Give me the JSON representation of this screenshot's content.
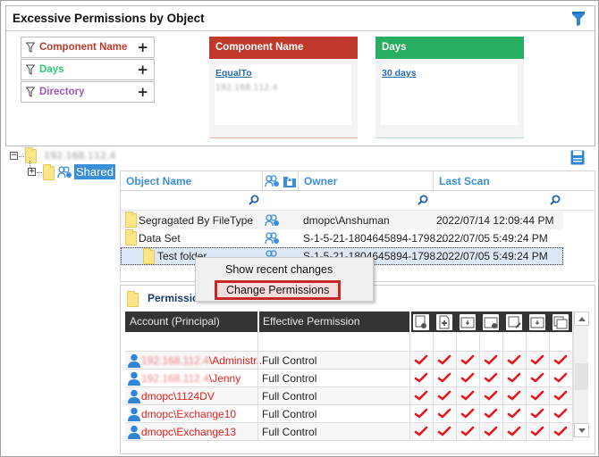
{
  "header": {
    "title": "Excessive Permissions by Object",
    "filter_icon": "funnel-icon"
  },
  "filters": [
    {
      "label": "Component Name",
      "color": "#c0392b",
      "icon": "filter-icon",
      "action": "+"
    },
    {
      "label": "Days",
      "color": "#27ae60",
      "icon": "filter-icon",
      "action": "+"
    },
    {
      "label": "Directory",
      "color": "#8e44ad",
      "icon": "filter-icon",
      "action": "+"
    }
  ],
  "cards": [
    {
      "title": "Component Name",
      "color": "#c0392b",
      "operator": "EqualTo",
      "value": "192.168.112.4"
    },
    {
      "title": "Days",
      "color": "#27ae60",
      "operator": "30 days",
      "value": ""
    }
  ],
  "tree": {
    "root": "192.168.112.4",
    "root_toggle": "−",
    "child": "Shared",
    "child_toggle": "+"
  },
  "grid": {
    "columns": [
      "Object Name",
      "Owner",
      "Last Scan"
    ],
    "rows": [
      {
        "name": "Segragated By FileType",
        "owner": "dmopc\\Anshuman",
        "last_scan": "2022/07/14 12:09:44 PM"
      },
      {
        "name": "Data Set",
        "owner": "S-1-5-21-1804645894-1798...",
        "last_scan": "2022/07/05 5:49:24 PM"
      },
      {
        "name": "Test folder",
        "owner": "S-1-5-21-1804645894-1798...",
        "last_scan": "2022/07/05 5:49:24 PM"
      }
    ]
  },
  "context_menu": {
    "items": [
      "Show recent changes",
      "Change Permissions"
    ]
  },
  "permissions": {
    "title": "Permissions",
    "columns": [
      "Account (Principal)",
      "Effective Permission"
    ],
    "icon_columns": [
      "list-folder-icon",
      "create-file-icon",
      "create-folder-icon",
      "read-attributes-icon",
      "write-attributes-icon",
      "append-icon",
      "delete-icon"
    ],
    "rows": [
      {
        "prefix": "192.168.112.4",
        "account": "\\Administr...",
        "permission": "Full Control"
      },
      {
        "prefix": "192.168.112.4",
        "account": "\\Jenny",
        "permission": "Full Control"
      },
      {
        "prefix": "",
        "account": "dmopc\\1124DV",
        "permission": "Full Control"
      },
      {
        "prefix": "",
        "account": "dmopc\\Exchange10",
        "permission": "Full Control"
      },
      {
        "prefix": "",
        "account": "dmopc\\Exchange13",
        "permission": "Full Control"
      }
    ]
  }
}
